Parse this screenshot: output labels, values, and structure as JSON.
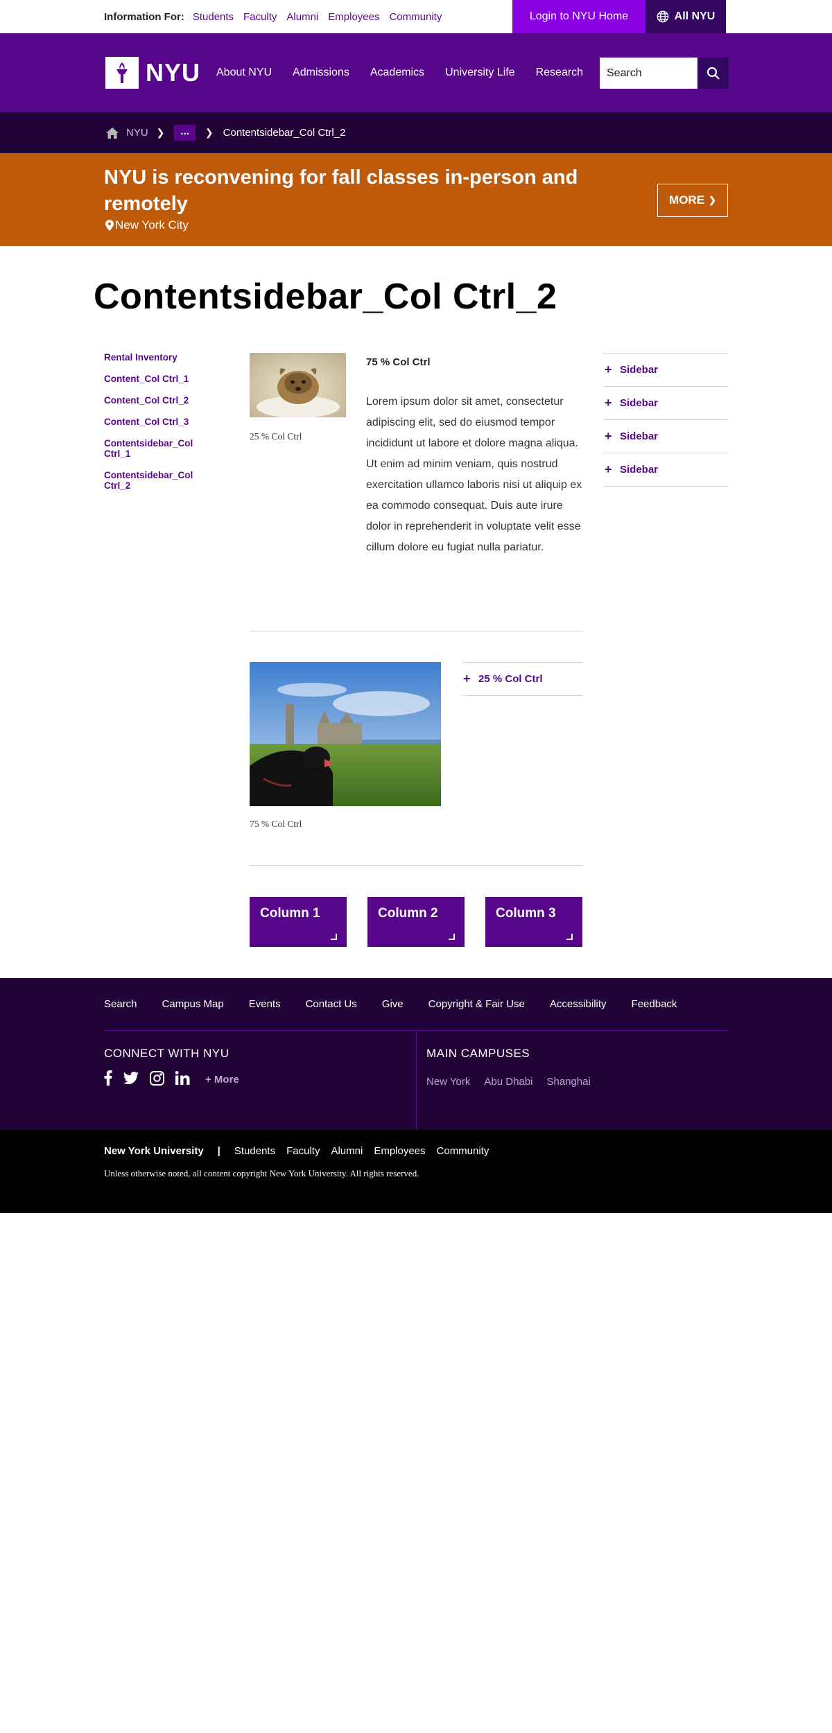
{
  "utility": {
    "info_label": "Information For:",
    "links": [
      "Students",
      "Faculty",
      "Alumni",
      "Employees",
      "Community"
    ],
    "login_label": "Login to NYU Home",
    "all_nyu_label": "All NYU"
  },
  "header": {
    "logo_text": "NYU",
    "nav": [
      "About NYU",
      "Admissions",
      "Academics",
      "University Life",
      "Research"
    ],
    "search_placeholder": "Search"
  },
  "breadcrumb": {
    "home": "NYU",
    "ellipsis": "...",
    "current": "Contentsidebar_Col Ctrl_2"
  },
  "alert": {
    "title": "NYU is reconvening for fall classes in-person and remotely",
    "location": "New York City",
    "more_label": "MORE"
  },
  "page": {
    "title": "Contentsidebar_Col Ctrl_2"
  },
  "left_nav": [
    "Rental Inventory",
    "Content_Col Ctrl_1",
    "Content_Col Ctrl_2",
    "Content_Col Ctrl_3",
    "Contentsidebar_Col Ctrl_1",
    "Contentsidebar_Col Ctrl_2"
  ],
  "section1": {
    "image_caption": "25 % Col Ctrl",
    "subhead": "75 % Col Ctrl",
    "body": "Lorem ipsum dolor sit amet, consectetur adipiscing elit, sed do eiusmod tempor incididunt ut labore et dolore magna aliqua. Ut enim ad minim veniam, quis nostrud exercitation ullamco laboris nisi ut aliquip ex ea commodo consequat. Duis aute irure dolor in reprehenderit in voluptate velit esse cillum dolore eu fugiat nulla pariatur."
  },
  "section2": {
    "image_caption": "75 % Col Ctrl",
    "accordion": [
      "25 % Col Ctrl"
    ]
  },
  "columns": [
    "Column 1",
    "Column 2",
    "Column 3"
  ],
  "sidebar": [
    "Sidebar",
    "Sidebar",
    "Sidebar",
    "Sidebar"
  ],
  "footer": {
    "links": [
      "Search",
      "Campus Map",
      "Events",
      "Contact Us",
      "Give",
      "Copyright & Fair Use",
      "Accessibility",
      "Feedback"
    ],
    "connect_heading": "CONNECT WITH NYU",
    "social_more": "+ More",
    "campuses_heading": "MAIN CAMPUSES",
    "campuses": [
      "New York",
      "Abu Dhabi",
      "Shanghai"
    ],
    "university": "New York University",
    "bottom_links": [
      "Students",
      "Faculty",
      "Alumni",
      "Employees",
      "Community"
    ],
    "copyright": "Unless otherwise noted, all content copyright New York University. All rights reserved."
  },
  "colors": {
    "violet": "#57068c",
    "ultraviolet": "#8900e1",
    "deep_violet": "#330662",
    "night": "#220337",
    "alert_orange": "#c05a0b"
  },
  "icons": [
    "home-icon",
    "globe-icon",
    "search-icon",
    "torch-icon",
    "location-pin-icon",
    "chevron-right-icon",
    "plus-icon",
    "facebook-icon",
    "twitter-icon",
    "instagram-icon",
    "linkedin-icon"
  ]
}
